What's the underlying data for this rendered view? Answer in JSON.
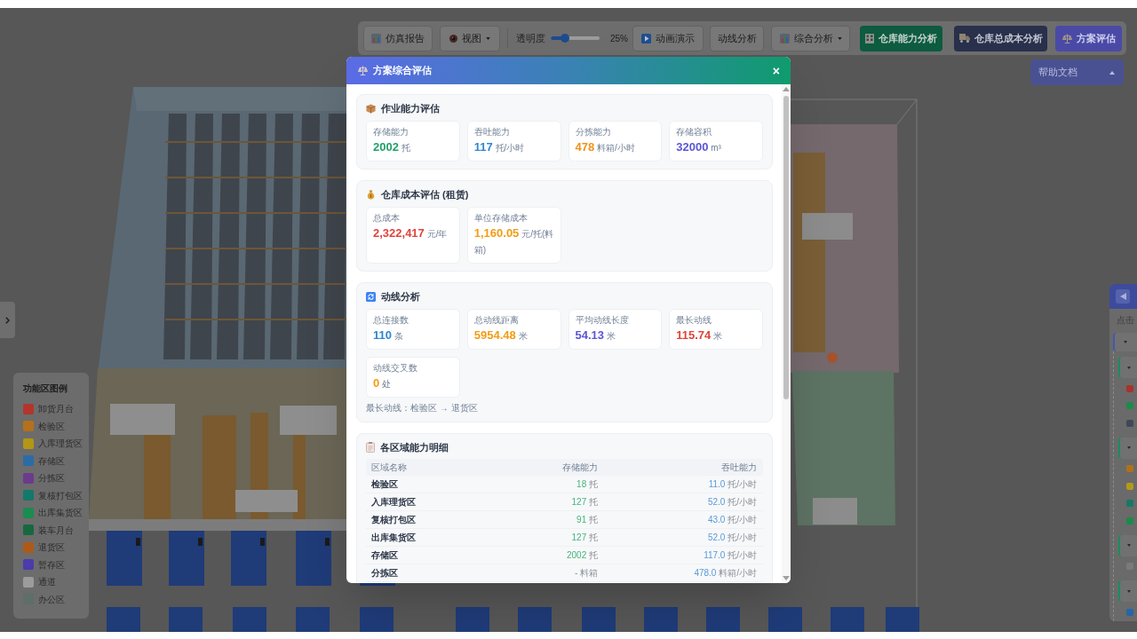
{
  "toolbar": {
    "report_button": {
      "label": "仿真报告"
    },
    "view_menu": {
      "label": "视图"
    },
    "opacity": {
      "label": "透明度",
      "level": 0.25,
      "reading": "25%"
    },
    "animation_button": {
      "label": "动画演示"
    },
    "flow_button": {
      "label": "动线分析"
    },
    "analysis_menu": {
      "label": "综合分析"
    },
    "capacity_button": {
      "label": "仓库能力分析"
    },
    "cost_button": {
      "label": "仓库总成本分析"
    },
    "evaluation_button": {
      "label": "方案评估"
    }
  },
  "help_button": {
    "label": "帮助文档"
  },
  "legend": {
    "title": "功能区图例",
    "items": [
      {
        "label": "卸货月台",
        "color": "#b3352c"
      },
      {
        "label": "检验区",
        "color": "#b5701c"
      },
      {
        "label": "入库理货区",
        "color": "#b39614"
      },
      {
        "label": "存储区",
        "color": "#2b6ca6"
      },
      {
        "label": "分拣区",
        "color": "#6b3b8c"
      },
      {
        "label": "复核打包区",
        "color": "#14786a"
      },
      {
        "label": "出库集货区",
        "color": "#1a8c4e"
      },
      {
        "label": "装车月台",
        "color": "#17683f"
      },
      {
        "label": "退货区",
        "color": "#ad5a19"
      },
      {
        "label": "暂存区",
        "color": "#4b3bab"
      },
      {
        "label": "通道",
        "color": "#9c9c9c"
      },
      {
        "label": "办公区",
        "color": "#5e6e68"
      }
    ]
  },
  "side_panel": {
    "hint": "点击",
    "tree": [
      {
        "expanded": true,
        "children": [
          {
            "expanded": true,
            "children": [
              {
                "color": "#a8332c"
              },
              {
                "color": "#1d8a4c"
              },
              {
                "color": "#404858"
              }
            ]
          },
          {
            "expanded": true,
            "children": [
              {
                "color": "#b0701c"
              },
              {
                "color": "#b39a1a"
              },
              {
                "color": "#177868"
              },
              {
                "color": "#1d8a4c"
              }
            ]
          },
          {
            "expanded": true,
            "children": [
              {
                "color": "#7a7a7a"
              }
            ]
          },
          {
            "expanded": true,
            "children": [
              {
                "color": "#2466a8"
              }
            ]
          }
        ]
      }
    ]
  },
  "dialog": {
    "title": "方案综合评估",
    "close": "×",
    "sections": [
      {
        "kind": "stats",
        "title": "作业能力评估",
        "stats": [
          {
            "label": "存储能力",
            "value": "2002",
            "unit": "托",
            "color": "#1fa06a"
          },
          {
            "label": "吞吐能力",
            "value": "117",
            "unit": "托/小时",
            "color": "#2f86cf"
          },
          {
            "label": "分拣能力",
            "value": "478",
            "unit": "料箱/小时",
            "color": "#f0921c"
          },
          {
            "label": "存储容积",
            "value": "32000",
            "unit": "m³",
            "color": "#5b55d6"
          }
        ]
      },
      {
        "kind": "stats",
        "title": "仓库成本评估 (租赁)",
        "stats": [
          {
            "label": "总成本",
            "value": "2,322,417",
            "unit": "元/年",
            "color": "#e0433a"
          },
          {
            "label": "单位存储成本",
            "value": "1,160.05",
            "unit": "元/托(料箱)",
            "color": "#f39c12"
          }
        ]
      },
      {
        "kind": "stats",
        "title": "动线分析",
        "stats": [
          {
            "label": "总连接数",
            "value": "110",
            "unit": "条",
            "color": "#2f86cf"
          },
          {
            "label": "总动线距离",
            "value": "5954.48",
            "unit": "米",
            "color": "#f39c12"
          },
          {
            "label": "平均动线长度",
            "value": "54.13",
            "unit": "米",
            "color": "#5b55d6"
          },
          {
            "label": "最长动线",
            "value": "115.74",
            "unit": "米",
            "color": "#e0433a"
          },
          {
            "label": "动线交叉数",
            "value": "0",
            "unit": "处",
            "color": "#f39c12"
          }
        ],
        "note": "最长动线：检验区 → 退货区"
      },
      {
        "kind": "table",
        "title": "各区域能力明细",
        "columns": [
          "区域名称",
          "存储能力",
          "吞吐能力"
        ],
        "rows": [
          {
            "name": "检验区",
            "storage": {
              "value": "18",
              "unit": "托"
            },
            "throughput": {
              "value": "11.0",
              "unit": "托/小时"
            }
          },
          {
            "name": "入库理货区",
            "storage": {
              "value": "127",
              "unit": "托"
            },
            "throughput": {
              "value": "52.0",
              "unit": "托/小时"
            }
          },
          {
            "name": "复核打包区",
            "storage": {
              "value": "91",
              "unit": "托"
            },
            "throughput": {
              "value": "43.0",
              "unit": "托/小时"
            }
          },
          {
            "name": "出库集货区",
            "storage": {
              "value": "127",
              "unit": "托"
            },
            "throughput": {
              "value": "52.0",
              "unit": "托/小时"
            }
          },
          {
            "name": "存储区",
            "storage": {
              "value": "2002",
              "unit": "托"
            },
            "throughput": {
              "value": "117.0",
              "unit": "托/小时"
            }
          },
          {
            "name": "分拣区",
            "storage": {
              "value": "-",
              "unit": "料箱"
            },
            "throughput": {
              "value": "478.0",
              "unit": "料箱/小时"
            }
          }
        ]
      }
    ]
  }
}
